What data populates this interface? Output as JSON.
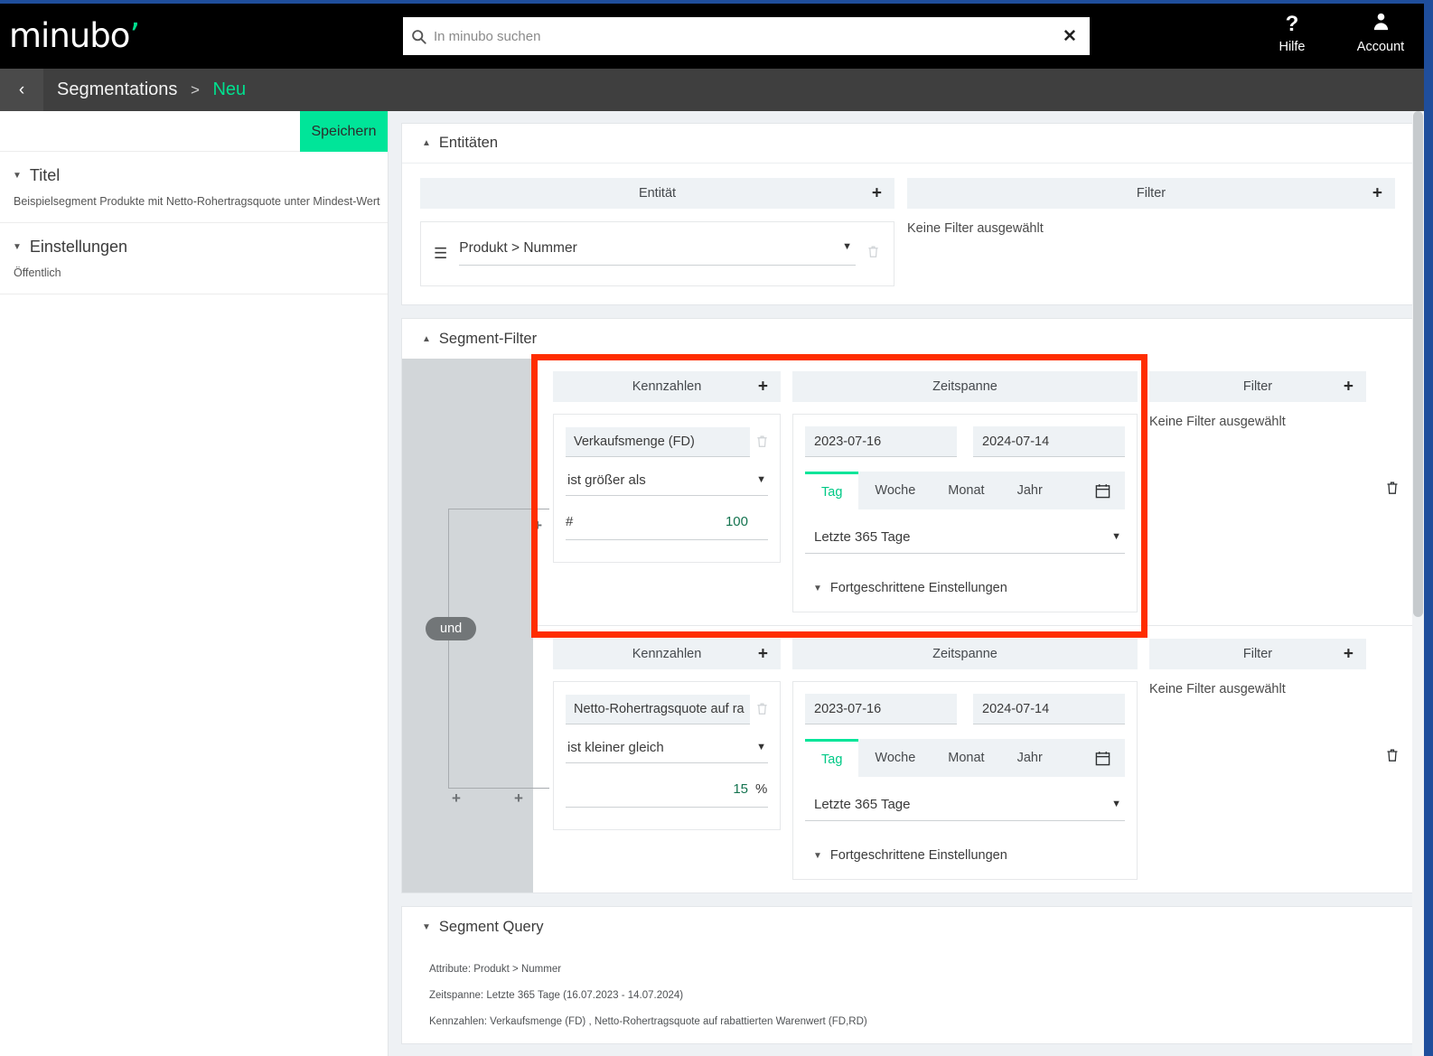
{
  "brand": {
    "logo_text": "minubo",
    "accent": "#00e599",
    "highlight": "#ff2d00"
  },
  "topbar": {
    "search": {
      "placeholder": "In minubo suchen",
      "value": "",
      "icon": "search-icon",
      "clear_icon": "close-icon"
    },
    "help": {
      "label": "Hilfe",
      "icon": "question-mark-icon"
    },
    "account": {
      "label": "Account",
      "icon": "user-icon"
    }
  },
  "breadcrumb": {
    "back_icon": "chevron-left-icon",
    "root": "Segmentations",
    "separator": ">",
    "current": "Neu"
  },
  "sidebar": {
    "save_label": "Speichern",
    "sections": [
      {
        "title": "Titel",
        "value": "Beispielsegment Produkte mit Netto-Rohertragsquote unter Mindest-Wert",
        "caret": "caret-down-icon"
      },
      {
        "title": "Einstellungen",
        "value": "Öffentlich",
        "caret": "caret-down-icon"
      }
    ]
  },
  "entities_card": {
    "title": "Entitäten",
    "caret": "caret-up-icon",
    "entity_column": {
      "header": "Entität",
      "add_icon": "plus-icon"
    },
    "filter_column": {
      "header": "Filter",
      "add_icon": "plus-icon",
      "empty_text": "Keine Filter ausgewählt"
    },
    "entity_row": {
      "drag_icon": "hamburger-drag-icon",
      "value": "Produkt > Nummer",
      "dropdown_icon": "caret-down-icon",
      "delete_icon": "trash-icon"
    }
  },
  "segment_filter_card": {
    "title": "Segment-Filter",
    "caret": "caret-up-icon",
    "connector": {
      "label": "und",
      "group_add_icon": "plus-icon",
      "add_left_icon": "plus-icon",
      "add_right_icon": "plus-icon"
    },
    "columns": {
      "kpi_header": "Kennzahlen",
      "time_header": "Zeitspanne",
      "filter_header": "Filter",
      "add_icon": "plus-icon",
      "filter_empty": "Keine Filter ausgewählt"
    },
    "granularity_tabs": [
      "Tag",
      "Woche",
      "Monat",
      "Jahr"
    ],
    "calendar_icon": "calendar-icon",
    "advanced_label": "Fortgeschrittene Einstellungen",
    "advanced_caret": "caret-down-icon",
    "row_delete_icon": "trash-icon",
    "rows": [
      {
        "highlighted": true,
        "kpi": {
          "metric": "Verkaufsmenge (FD)",
          "delete_icon": "trash-icon",
          "operator": "ist größer als",
          "operator_caret": "caret-down-icon",
          "unit_left": "#",
          "value": "100",
          "unit_right": ""
        },
        "time": {
          "date_from": "2023-07-16",
          "date_to": "2024-07-14",
          "active_tab": "Tag",
          "range": "Letzte 365 Tage",
          "range_caret": "caret-down-icon"
        }
      },
      {
        "highlighted": false,
        "kpi": {
          "metric": "Netto-Rohertragsquote auf ra",
          "delete_icon": "trash-icon",
          "operator": "ist kleiner gleich",
          "operator_caret": "caret-down-icon",
          "unit_left": "",
          "value": "15",
          "unit_right": "%"
        },
        "time": {
          "date_from": "2023-07-16",
          "date_to": "2024-07-14",
          "active_tab": "Tag",
          "range": "Letzte 365 Tage",
          "range_caret": "caret-down-icon"
        }
      }
    ]
  },
  "segment_query_card": {
    "title": "Segment Query",
    "caret": "caret-down-icon",
    "lines": [
      {
        "key": "Attribute:",
        "value": "Produkt > Nummer"
      },
      {
        "key": "Zeitspanne:",
        "value": "Letzte 365 Tage (16.07.2023 - 14.07.2024)"
      },
      {
        "key": "Kennzahlen:",
        "value": "Verkaufsmenge (FD) , Netto-Rohertragsquote auf rabattierten Warenwert (FD,RD)"
      }
    ]
  }
}
